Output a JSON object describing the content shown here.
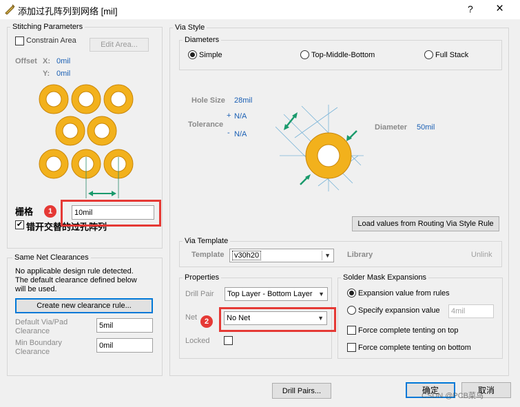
{
  "window": {
    "title": "添加过孔阵列到网络 [mil]",
    "help": "?",
    "close": "×"
  },
  "stitching": {
    "legend": "Stitching Parameters",
    "constrain_label": "Constrain Area",
    "edit_area_label": "Edit Area...",
    "offset_label": "Offset",
    "x_label": "X:",
    "x_value": "0mil",
    "y_label": "Y:",
    "y_value": "0mil",
    "grid_label": "栅格",
    "grid_value": "10mil",
    "stagger_label": "错开交替的过孔阵列",
    "stagger_checked": true
  },
  "clearances": {
    "legend": "Same Net Clearances",
    "message_line1": "No applicable design rule detected.",
    "message_line2": "The default clearance defined below",
    "message_line3": "will be used.",
    "create_rule_label": "Create new clearance rule...",
    "default_via_label_1": "Default Via/Pad",
    "default_via_label_2": "Clearance",
    "default_via_value": "5mil",
    "min_boundary_label_1": "Min Boundary",
    "min_boundary_label_2": "Clearance",
    "min_boundary_value": "0mil"
  },
  "via_style": {
    "legend": "Via Style",
    "diameters_legend": "Diameters",
    "simple_label": "Simple",
    "tmb_label": "Top-Middle-Bottom",
    "full_stack_label": "Full Stack",
    "selected": "simple",
    "hole_size_label": "Hole Size",
    "hole_size_value": "28mil",
    "tolerance_label": "Tolerance",
    "tol_plus_sign": "+",
    "tol_plus_value": "N/A",
    "tol_minus_sign": "-",
    "tol_minus_value": "N/A",
    "diameter_label": "Diameter",
    "diameter_value": "50mil",
    "load_values_label": "Load values from Routing Via Style Rule"
  },
  "via_template": {
    "legend": "Via Template",
    "template_label": "Template",
    "template_value": "v30h20",
    "library_label": "Library",
    "unlink_label": "Unlink"
  },
  "properties": {
    "legend": "Properties",
    "drill_pair_label": "Drill Pair",
    "drill_pair_value": "Top Layer - Bottom Layer",
    "net_label": "Net",
    "net_value": "No Net",
    "locked_label": "Locked"
  },
  "solder_mask": {
    "legend": "Solder Mask Expansions",
    "from_rules_label": "Expansion value from rules",
    "specify_label": "Specify expansion value",
    "specify_value": "4mil",
    "tent_top_label": "Force complete tenting on top",
    "tent_bottom_label": "Force complete tenting on bottom"
  },
  "footer": {
    "drill_pairs_label": "Drill Pairs...",
    "ok_label": "确定",
    "cancel_label": "取消",
    "watermark": "CSDN @PCB菜鸟"
  },
  "annotations": {
    "badge_1": "1",
    "badge_2": "2"
  },
  "colors": {
    "via_ring": "#f2b11c",
    "via_ring_edge": "#c8860a",
    "dimension_arrow": "#1a9a6c",
    "highlight": "#e53935",
    "value_text": "#1a5fb4"
  }
}
